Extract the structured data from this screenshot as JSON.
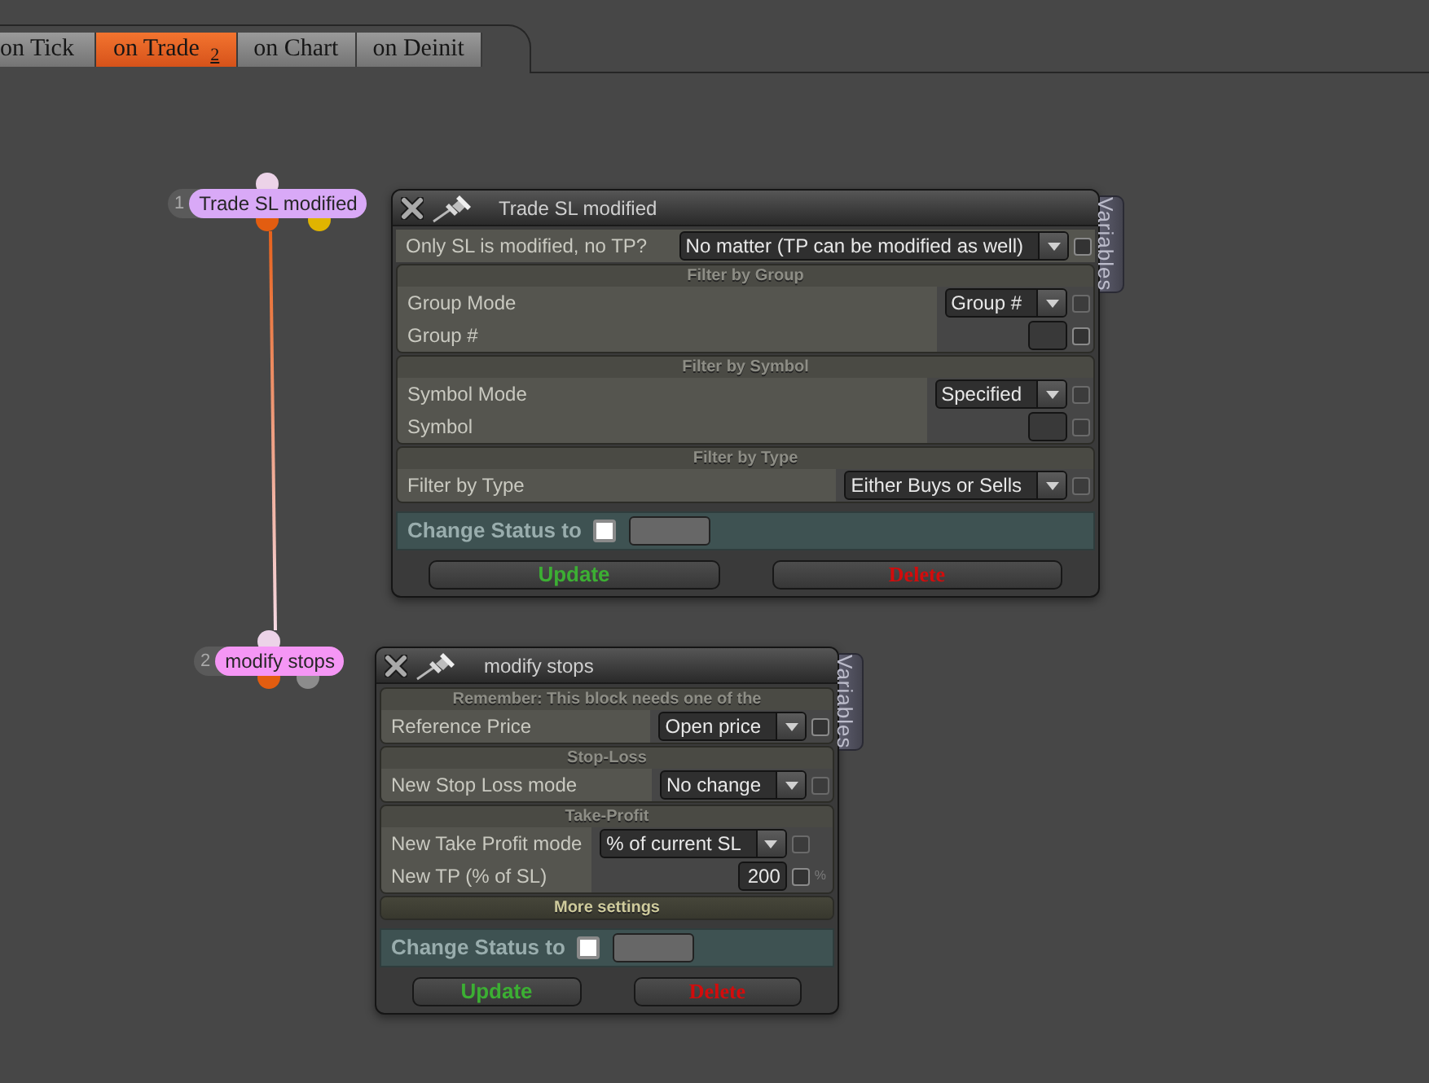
{
  "tabs": [
    {
      "label": "on Tick",
      "selected": false
    },
    {
      "label": "on Trade $_{2}$",
      "selected": true
    },
    {
      "label": "on Chart",
      "selected": false
    },
    {
      "label": "on Deinit",
      "selected": false
    }
  ],
  "nodes": [
    {
      "number": "1",
      "label": "Trade SL modified",
      "color": "#d9a9f7",
      "outputs": [
        {
          "color": "#e35d10"
        },
        {
          "color": "#e0b400"
        }
      ]
    },
    {
      "number": "2",
      "label": "modify stops",
      "color": "#f596f5",
      "outputs": [
        {
          "color": "#e35d10"
        },
        {
          "color": "#8c8c8c"
        }
      ]
    }
  ],
  "panels": [
    {
      "title": "Trade SL modified",
      "side_tab": "Variables",
      "groups": [
        {
          "rows": [
            {
              "label": "Only SL is modified, no TP?",
              "control": {
                "kind": "dropdown",
                "value": "No matter (TP can be modified as well)"
              },
              "checkbox": {
                "checked": false,
                "disabled": false
              }
            }
          ]
        },
        {
          "title": "Filter by Group",
          "expanded": true,
          "rows": [
            {
              "label": "Group Mode",
              "control": {
                "kind": "dropdown",
                "value": "Group #"
              },
              "checkbox": {
                "checked": false,
                "disabled": true
              }
            },
            {
              "label": "Group #",
              "control": {
                "kind": "input"
              },
              "checkbox": {
                "checked": false,
                "disabled": false
              }
            }
          ]
        },
        {
          "title": "Filter by Symbol",
          "expanded": true,
          "rows": [
            {
              "label": "Symbol Mode",
              "control": {
                "kind": "dropdown",
                "value": "Specified"
              },
              "checkbox": {
                "checked": false,
                "disabled": true
              }
            },
            {
              "label": "Symbol",
              "control": {
                "kind": "input"
              },
              "checkbox": {
                "checked": false,
                "disabled": true
              }
            }
          ]
        },
        {
          "title": "Filter by Type",
          "expanded": true,
          "rows": [
            {
              "label": "Filter by Type",
              "control": {
                "kind": "dropdown",
                "value": "Either Buys or Sells"
              },
              "checkbox": {
                "checked": false,
                "disabled": true
              }
            }
          ]
        }
      ],
      "status": {
        "label": "Change Status to",
        "checked": false
      },
      "buttons": [
        {
          "kind": "update",
          "label": "Update"
        },
        {
          "kind": "delete",
          "label": "Delete"
        }
      ]
    },
    {
      "title": "modify stops",
      "side_tab": "Variables",
      "groups": [
        {
          "title": "Remember: This block needs one of the",
          "expanded": true,
          "rows": [
            {
              "label": "Reference Price",
              "control": {
                "kind": "dropdown",
                "value": "Open price"
              },
              "checkbox": {
                "checked": false,
                "disabled": false
              }
            }
          ]
        },
        {
          "title": "Stop-Loss",
          "expanded": true,
          "rows": [
            {
              "label": "New Stop Loss mode",
              "control": {
                "kind": "dropdown",
                "value": "No change"
              },
              "checkbox": {
                "checked": false,
                "disabled": true
              }
            }
          ]
        },
        {
          "title": "Take-Profit",
          "expanded": true,
          "rows": [
            {
              "label": "New Take Profit mode",
              "control": {
                "kind": "dropdown",
                "value": "% of current SL"
              },
              "checkbox": {
                "checked": false,
                "disabled": true
              }
            },
            {
              "label": "New TP (% of SL)",
              "control": {
                "kind": "number",
                "value": "200"
              },
              "checkbox": {
                "checked": false,
                "disabled": false
              },
              "suffix": "%"
            }
          ]
        },
        {
          "title": "More settings",
          "expanded": false
        }
      ],
      "status": {
        "label": "Change Status to",
        "checked": false
      },
      "buttons": [
        {
          "kind": "update",
          "label": "Update"
        },
        {
          "kind": "delete",
          "label": "Delete"
        }
      ]
    }
  ]
}
